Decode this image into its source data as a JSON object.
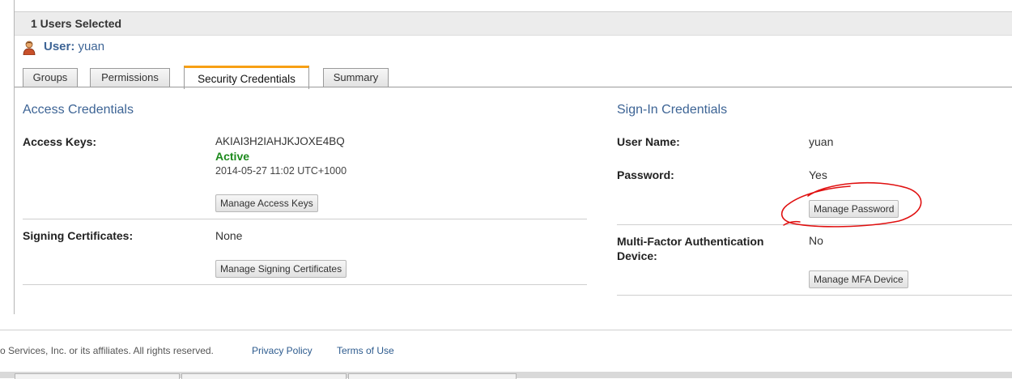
{
  "header": {
    "selected_text": "1 Users Selected",
    "user_label": "User:",
    "user_name": "yuan"
  },
  "tabs": [
    {
      "label": "Groups",
      "active": false
    },
    {
      "label": "Permissions",
      "active": false
    },
    {
      "label": "Security Credentials",
      "active": true
    },
    {
      "label": "Summary",
      "active": false
    }
  ],
  "access_credentials": {
    "title": "Access Credentials",
    "access_keys_label": "Access Keys:",
    "access_key_id": "AKIAI3H2IAHJKJOXE4BQ",
    "access_key_status": "Active",
    "access_key_created": "2014-05-27 11:02 UTC+1000",
    "manage_access_keys": "Manage Access Keys",
    "signing_certs_label": "Signing Certificates:",
    "signing_certs_value": "None",
    "manage_signing_certs": "Manage Signing Certificates"
  },
  "signin_credentials": {
    "title": "Sign-In Credentials",
    "user_name_label": "User Name:",
    "user_name_value": "yuan",
    "password_label": "Password:",
    "password_value": "Yes",
    "manage_password": "Manage Password",
    "mfa_label_line1": "Multi-Factor Authentication",
    "mfa_label_line2": "Device:",
    "mfa_value": "No",
    "manage_mfa": "Manage MFA Device"
  },
  "footer": {
    "copyright": "o Services, Inc. or its affiliates. All rights reserved.",
    "privacy": "Privacy Policy",
    "terms": "Terms of Use"
  },
  "colors": {
    "accent_tab": "#f7a014",
    "section_title": "#3d6495",
    "status_active": "#1d8a1d",
    "annotation": "#e01010"
  }
}
